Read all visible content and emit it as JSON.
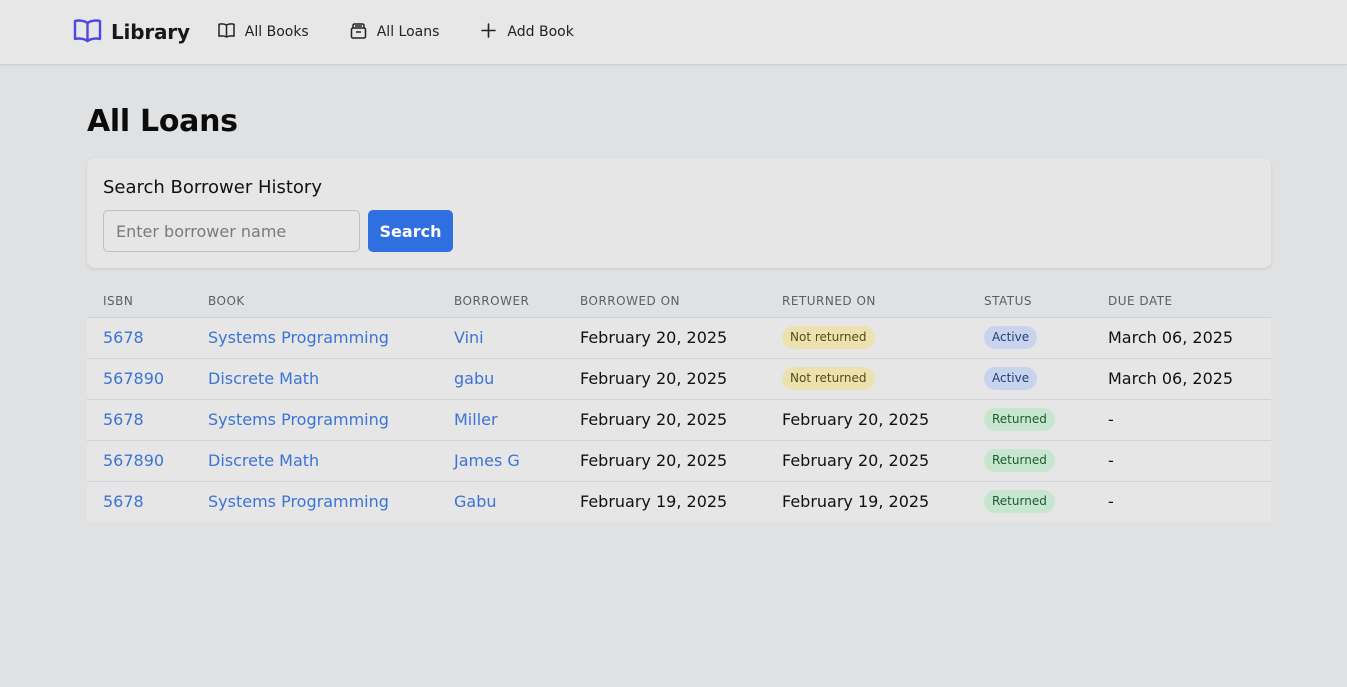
{
  "nav": {
    "brand": "Library",
    "links": [
      {
        "label": "All Books",
        "icon": "book-open-icon"
      },
      {
        "label": "All Loans",
        "icon": "archive-icon"
      },
      {
        "label": "Add Book",
        "icon": "plus-icon"
      }
    ]
  },
  "page": {
    "title": "All Loans"
  },
  "search": {
    "title": "Search Borrower History",
    "placeholder": "Enter borrower name",
    "button": "Search"
  },
  "table": {
    "headers": [
      "ISBN",
      "BOOK",
      "BORROWER",
      "BORROWED ON",
      "RETURNED ON",
      "STATUS",
      "DUE DATE"
    ],
    "rows": [
      {
        "isbn": "5678",
        "book": "Systems Programming",
        "borrower": "Vini",
        "borrowed_on": "February 20, 2025",
        "returned_on": "Not returned",
        "returned_pill": true,
        "status": "Active",
        "due_date": "March 06, 2025"
      },
      {
        "isbn": "567890",
        "book": "Discrete Math",
        "borrower": "gabu",
        "borrowed_on": "February 20, 2025",
        "returned_on": "Not returned",
        "returned_pill": true,
        "status": "Active",
        "due_date": "March 06, 2025"
      },
      {
        "isbn": "5678",
        "book": "Systems Programming",
        "borrower": "Miller",
        "borrowed_on": "February 20, 2025",
        "returned_on": "February 20, 2025",
        "returned_pill": false,
        "status": "Returned",
        "due_date": "-"
      },
      {
        "isbn": "567890",
        "book": "Discrete Math",
        "borrower": "James G",
        "borrowed_on": "February 20, 2025",
        "returned_on": "February 20, 2025",
        "returned_pill": false,
        "status": "Returned",
        "due_date": "-"
      },
      {
        "isbn": "5678",
        "book": "Systems Programming",
        "borrower": "Gabu",
        "borrowed_on": "February 19, 2025",
        "returned_on": "February 19, 2025",
        "returned_pill": false,
        "status": "Returned",
        "due_date": "-"
      }
    ]
  },
  "colors": {
    "brand_icon": "#4f46e5",
    "link": "#3b74d6",
    "primary_button": "#2f6fe0",
    "status_active_bg": "#c8d4ee",
    "status_returned_bg": "#c6e6cf",
    "not_returned_bg": "#ece2b0"
  }
}
